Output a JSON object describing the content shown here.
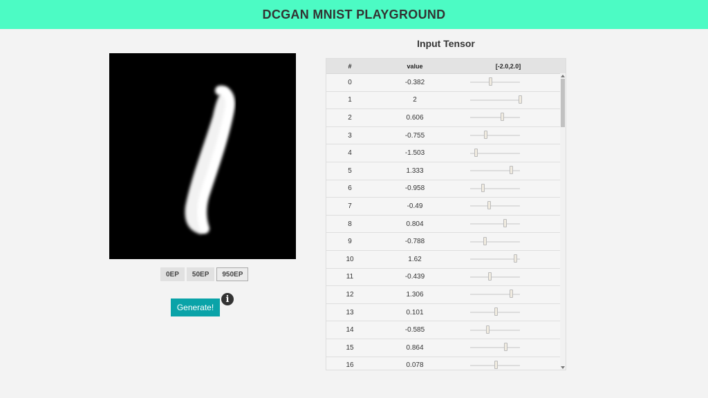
{
  "header": {
    "title": "DCGAN MNIST PLAYGROUND"
  },
  "epochs": [
    {
      "label": "0EP",
      "active": false
    },
    {
      "label": "50EP",
      "active": false
    },
    {
      "label": "950EP",
      "active": true
    }
  ],
  "generate": {
    "label": "Generate!"
  },
  "info_icon": "info-icon",
  "panel": {
    "title": "Input Tensor",
    "columns": {
      "index": "#",
      "value": "value",
      "range": "[-2.0,2.0]"
    },
    "range_min": -2.0,
    "range_max": 2.0,
    "rows": [
      {
        "index": "0",
        "value": "-0.382"
      },
      {
        "index": "1",
        "value": "2"
      },
      {
        "index": "2",
        "value": "0.606"
      },
      {
        "index": "3",
        "value": "-0.755"
      },
      {
        "index": "4",
        "value": "-1.503"
      },
      {
        "index": "5",
        "value": "1.333"
      },
      {
        "index": "6",
        "value": "-0.958"
      },
      {
        "index": "7",
        "value": "-0.49"
      },
      {
        "index": "8",
        "value": "0.804"
      },
      {
        "index": "9",
        "value": "-0.788"
      },
      {
        "index": "10",
        "value": "1.62"
      },
      {
        "index": "11",
        "value": "-0.439"
      },
      {
        "index": "12",
        "value": "1.306"
      },
      {
        "index": "13",
        "value": "0.101"
      },
      {
        "index": "14",
        "value": "-0.585"
      },
      {
        "index": "15",
        "value": "0.864"
      },
      {
        "index": "16",
        "value": "0.078"
      }
    ]
  }
}
